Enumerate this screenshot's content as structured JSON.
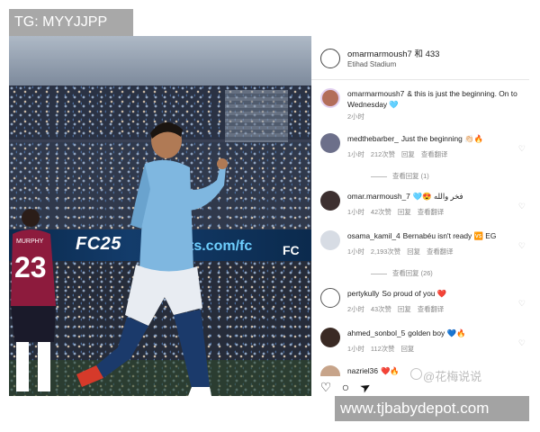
{
  "watermark_top": "TG: MYYJJPP",
  "watermark_bottom": "www.tjbabydepot.com",
  "watermark_overlay": "@花梅说说",
  "photo": {
    "ad_left": "FC25",
    "ad_middle": "ts.com/fc",
    "ad_right": "FC",
    "player_left_name": "MURPHY",
    "player_left_number": "23"
  },
  "post": {
    "title": "omarmarmoush7 和 433",
    "subtitle": "Etihad Stadium"
  },
  "comments": [
    {
      "user": "omarmarmoush7",
      "text": "& this is just the beginning. On to Wednesday 🩵",
      "meta": [
        "2小时"
      ],
      "view_replies": ""
    },
    {
      "user": "medthebarber_",
      "text": "Just the beginning 👏🏻🔥",
      "meta": [
        "1小时",
        "212次赞",
        "回复",
        "查看翻译"
      ],
      "view_replies": "查看回复 (1)"
    },
    {
      "user": "omar.marmoush_7",
      "text": "🩵😍 فخر والله",
      "meta": [
        "1小时",
        "42次赞",
        "回复",
        "查看翻译"
      ],
      "view_replies": ""
    },
    {
      "user": "osama_kamil_4",
      "text": "Bernabéu isn't ready 🆚 EG",
      "meta": [
        "1小时",
        "2,193次赞",
        "回复",
        "查看翻译"
      ],
      "view_replies": "查看回复 (26)"
    },
    {
      "user": "pertykully",
      "text": "So proud of you ❤️",
      "meta": [
        "2小时",
        "43次赞",
        "回复",
        "查看翻译"
      ],
      "view_replies": ""
    },
    {
      "user": "ahmed_sonbol_5",
      "text": "golden boy 💙🔥",
      "meta": [
        "1小时",
        "112次赞",
        "回复"
      ],
      "view_replies": ""
    },
    {
      "user": "nazriel36",
      "text": "❤️🔥",
      "meta": [],
      "view_replies": ""
    }
  ],
  "actions": {
    "like": "♡",
    "comment": "○",
    "share": "➤"
  },
  "colors": {
    "city_blue": "#7fb7e0",
    "newcastle_red": "#8d1b3d",
    "ad_blue": "#0b2a4d"
  }
}
